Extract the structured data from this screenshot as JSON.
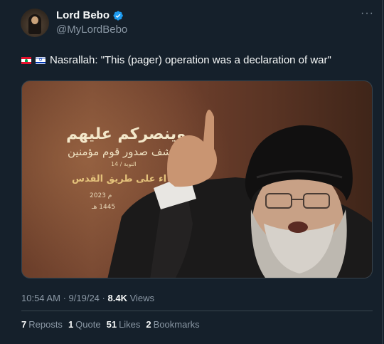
{
  "author": {
    "display_name": "Lord Bebo",
    "handle": "@MyLordBebo",
    "verified": true
  },
  "tweet": {
    "text": "Nasrallah: \"This (pager) operation was a declaration of war\"",
    "flags": [
      "lebanon-flag",
      "israel-flag"
    ]
  },
  "media": {
    "overlay_text": [
      "وينصركم عليهم",
      "ويشف صدور قوم مؤمنين",
      "النوبة / 14",
      "اء على طريق القدس",
      "م 2023",
      "1445 هـ"
    ]
  },
  "meta": {
    "time": "10:54 AM",
    "separator": "·",
    "date": "9/19/24",
    "views_count": "8.4K",
    "views_label": "Views"
  },
  "stats": {
    "reposts_count": "7",
    "reposts_label": "Reposts",
    "quotes_count": "1",
    "quotes_label": "Quote",
    "likes_count": "51",
    "likes_label": "Likes",
    "bookmarks_count": "2",
    "bookmarks_label": "Bookmarks"
  },
  "colors": {
    "background": "#15202b",
    "text": "#f7f9f9",
    "secondary_text": "#8b98a5",
    "verified": "#1d9bf0",
    "border": "#38444d"
  }
}
